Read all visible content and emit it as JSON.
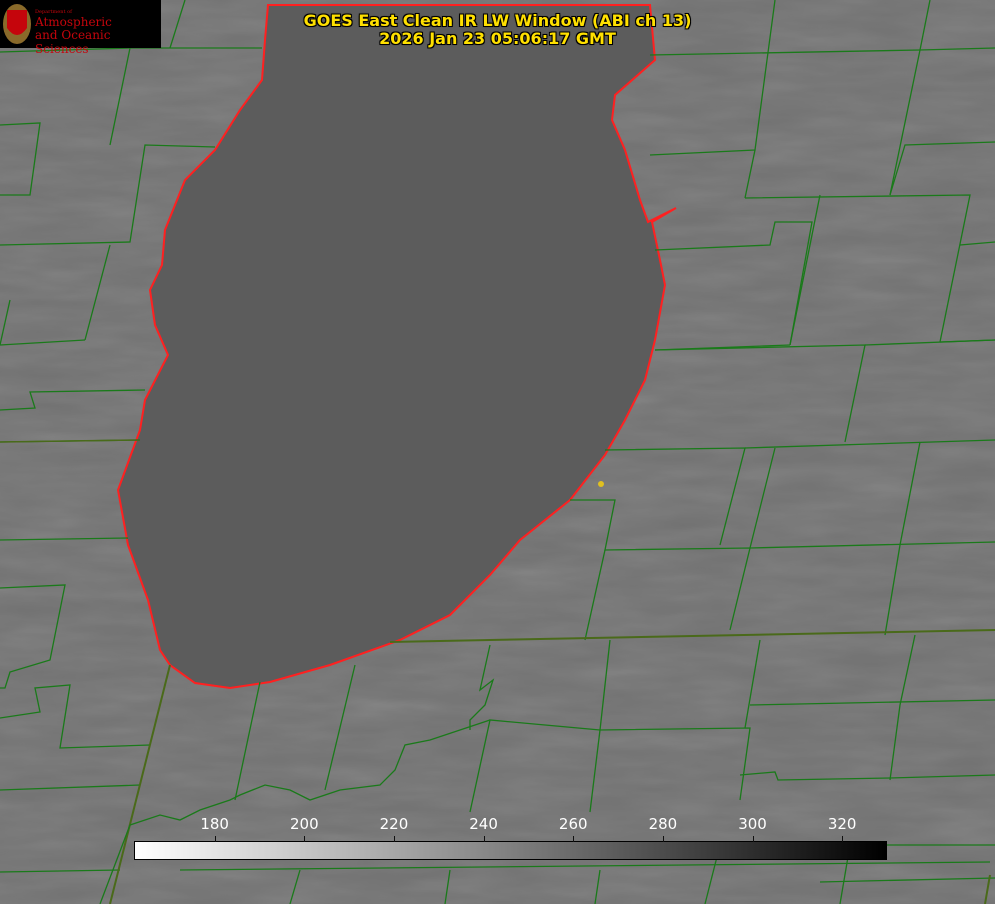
{
  "title": {
    "line1": "GOES East Clean IR LW Window (ABI ch 13)",
    "line2": "2026 Jan 23 05:06:17 GMT"
  },
  "logo": {
    "dept": "Department of",
    "line1": "Atmospheric",
    "line2": "and Oceanic Sciences",
    "crest_letter": "W"
  },
  "colorbar": {
    "ticks": [
      "180",
      "200",
      "220",
      "240",
      "260",
      "280",
      "300",
      "320"
    ],
    "range": [
      162,
      330
    ],
    "colors": {
      "low": "#ffffff",
      "high": "#000000"
    }
  },
  "colors": {
    "background": "#6f6f6f",
    "lake": "#5a5a5a",
    "county_lines": "#1a7a1a",
    "shoreline": "#ff2020",
    "title": "#ffe000",
    "marker": "#e0c020"
  },
  "icons": [
    "uw-crest-icon",
    "station-marker-icon"
  ]
}
